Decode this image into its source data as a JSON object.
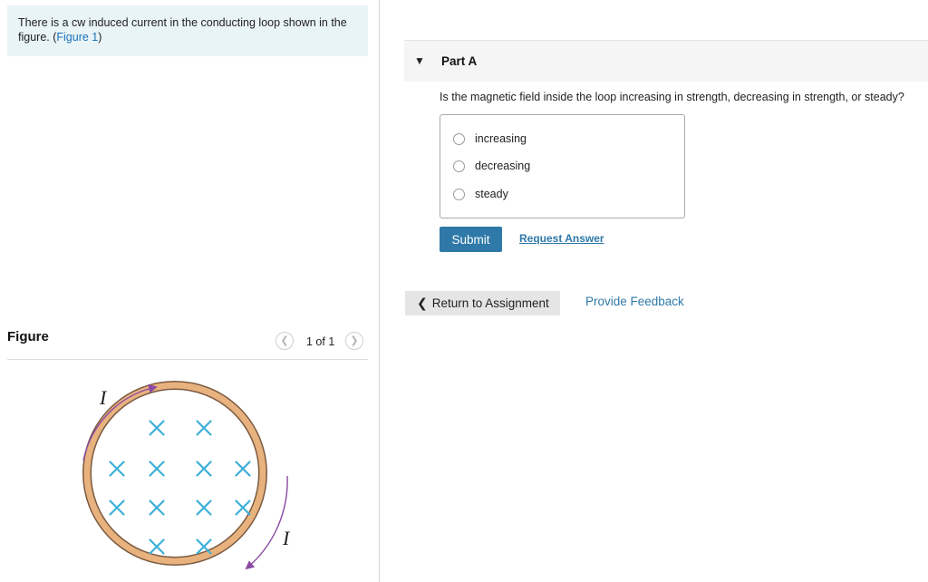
{
  "intro": {
    "text": "There is a cw induced current in the conducting loop shown in the figure. (",
    "figure_link": "Figure 1",
    "close_paren": ")"
  },
  "figure": {
    "title": "Figure",
    "counter": "1 of 1",
    "current_label_top": "I",
    "current_label_bottom": "I",
    "cross_mark": "×",
    "colors": {
      "loop": "#e8b27f",
      "loop_edge": "#7a5a40",
      "arrow": "#8a4aa2",
      "field_cross": "#3db0d8"
    }
  },
  "part": {
    "title": "Part A",
    "question": "Is the magnetic field inside the loop increasing in strength, decreasing in strength, or steady?",
    "choices": [
      {
        "label": "increasing"
      },
      {
        "label": "decreasing"
      },
      {
        "label": "steady"
      }
    ],
    "submit_label": "Submit",
    "request_answer_label": "Request Answer"
  },
  "footer": {
    "return_label": "Return to Assignment",
    "feedback_label": "Provide Feedback"
  },
  "colors": {
    "accent": "#2f79a8",
    "intro_bg": "#e9f4f7"
  }
}
